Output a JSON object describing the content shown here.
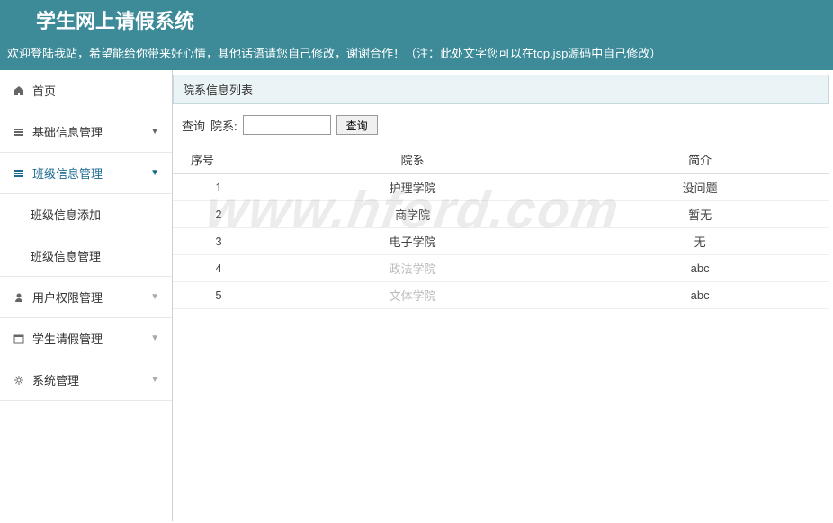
{
  "header": {
    "title": "学生网上请假系统"
  },
  "welcome": "欢迎登陆我站，希望能给你带来好心情，其他话语请您自己修改，谢谢合作！（注：此处文字您可以在top.jsp源码中自己修改）",
  "sidebar": {
    "home": "首页",
    "items": [
      {
        "label": "基础信息管理",
        "expanded": false
      },
      {
        "label": "班级信息管理",
        "expanded": true
      },
      {
        "label": "用户权限管理",
        "expanded": false
      },
      {
        "label": "学生请假管理",
        "expanded": false
      },
      {
        "label": "系统管理",
        "expanded": false
      }
    ],
    "subitems": [
      {
        "label": "班级信息添加"
      },
      {
        "label": "班级信息管理"
      }
    ]
  },
  "panel": {
    "title": "院系信息列表"
  },
  "search": {
    "label1": "查询",
    "label2": "院系:",
    "button": "查询",
    "value": ""
  },
  "table": {
    "headers": [
      "序号",
      "院系",
      "简介"
    ],
    "rows": [
      {
        "seq": "1",
        "dept": "护理学院",
        "intro": "没问题",
        "faded": false
      },
      {
        "seq": "2",
        "dept": "商学院",
        "intro": "暂无",
        "faded": false
      },
      {
        "seq": "3",
        "dept": "电子学院",
        "intro": "无",
        "faded": false
      },
      {
        "seq": "4",
        "dept": "政法学院",
        "intro": "abc",
        "faded": true
      },
      {
        "seq": "5",
        "dept": "文体学院",
        "intro": "abc",
        "faded": true
      }
    ]
  },
  "watermark": "www.hford.com"
}
